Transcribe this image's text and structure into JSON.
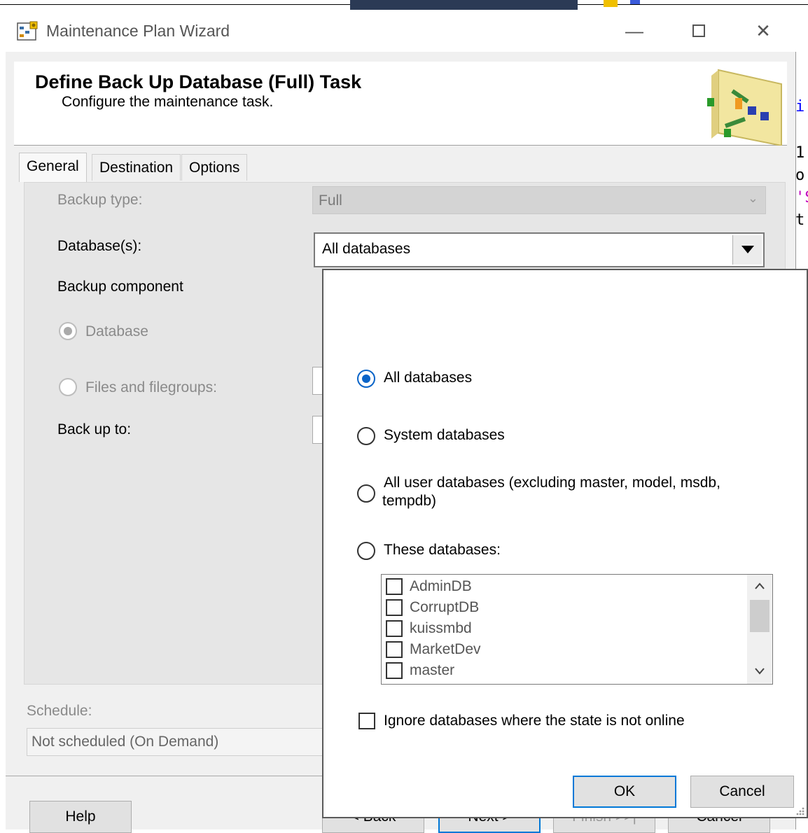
{
  "window": {
    "title": "Maintenance Plan Wizard",
    "header_title": "Define Back Up Database (Full) Task",
    "header_subtitle": "Configure the maintenance task."
  },
  "tabs": [
    {
      "label": "General",
      "active": true
    },
    {
      "label": "Destination",
      "active": false
    },
    {
      "label": "Options",
      "active": false
    }
  ],
  "general": {
    "backup_type_label": "Backup type:",
    "backup_type_value": "Full",
    "databases_label": "Database(s):",
    "databases_value": "All databases",
    "backup_component_label": "Backup component",
    "component_database": "Database",
    "component_files": "Files and filegroups:",
    "backup_to_label": "Back up to:"
  },
  "schedule": {
    "label": "Schedule:",
    "value": "Not scheduled (On Demand)"
  },
  "footer": {
    "help": "Help",
    "back": "< Back",
    "next": "Next >",
    "finish": "Finish >>|",
    "cancel": "Cancel"
  },
  "popup": {
    "options": [
      {
        "label": "All databases",
        "selected": true
      },
      {
        "label": "System databases",
        "selected": false
      },
      {
        "label": "All user databases  (excluding master, model, msdb,",
        "label2": "tempdb)",
        "selected": false
      },
      {
        "label": "These databases:",
        "selected": false
      }
    ],
    "databases": [
      "AdminDB",
      "CorruptDB",
      "kuissmbd",
      "MarketDev",
      "master"
    ],
    "ignore_offline": "Ignore databases where the state is not online",
    "ok": "OK",
    "cancel": "Cancel"
  },
  "background_code": [
    "i",
    "1",
    "o",
    "'S",
    "t"
  ]
}
